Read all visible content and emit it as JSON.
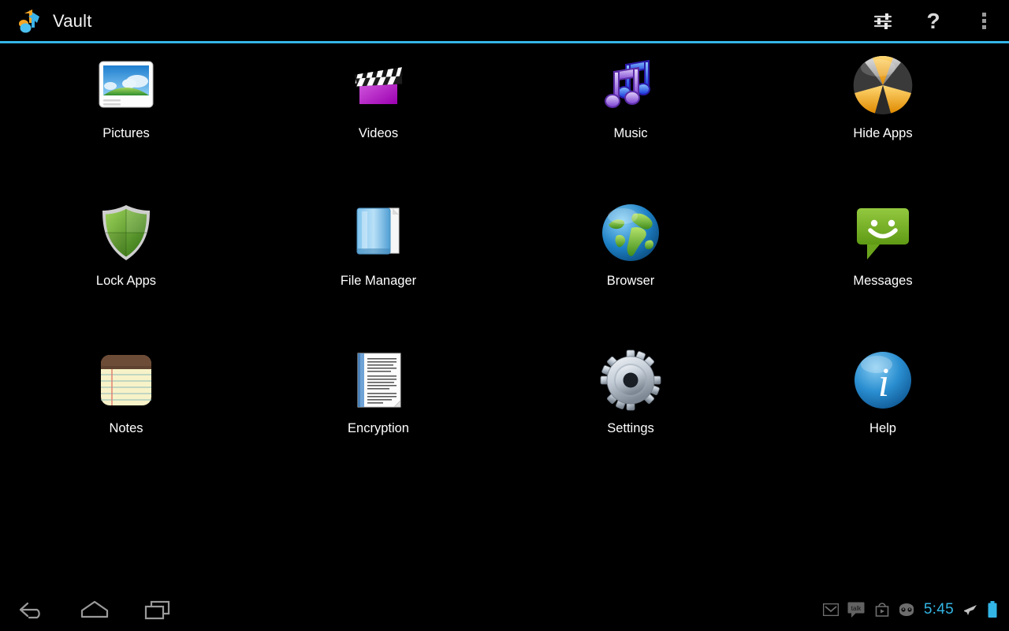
{
  "app": {
    "title": "Vault",
    "logo_icon": "music-note-logo-icon",
    "accent_color": "#33b5e5",
    "background_color": "#000000",
    "label_color": "#ffffff"
  },
  "action_bar": {
    "actions": [
      {
        "name": "settings-sliders-icon",
        "label": "Settings"
      },
      {
        "name": "help-question-icon",
        "label": "Help"
      },
      {
        "name": "overflow-menu-icon",
        "label": "More options"
      }
    ]
  },
  "grid": {
    "columns": 4,
    "items": [
      {
        "label": "Pictures",
        "icon": "pictures-icon"
      },
      {
        "label": "Videos",
        "icon": "videos-clapperboard-icon"
      },
      {
        "label": "Music",
        "icon": "music-notes-icon"
      },
      {
        "label": "Hide Apps",
        "icon": "hide-apps-radiation-icon"
      },
      {
        "label": "Lock Apps",
        "icon": "lock-apps-shield-icon"
      },
      {
        "label": "File Manager",
        "icon": "file-manager-folder-icon"
      },
      {
        "label": "Browser",
        "icon": "browser-globe-icon"
      },
      {
        "label": "Messages",
        "icon": "messages-bubble-icon"
      },
      {
        "label": "Notes",
        "icon": "notes-pad-icon"
      },
      {
        "label": "Encryption",
        "icon": "encryption-document-icon"
      },
      {
        "label": "Settings",
        "icon": "settings-gear-icon"
      },
      {
        "label": "Help",
        "icon": "help-info-icon"
      }
    ]
  },
  "nav_bar": {
    "buttons": [
      {
        "name": "back-button",
        "label": "Back"
      },
      {
        "name": "home-button",
        "label": "Home"
      },
      {
        "name": "recent-apps-button",
        "label": "Recent apps"
      }
    ]
  },
  "status_tray": {
    "icons": [
      {
        "name": "gmail-icon",
        "label": "Gmail"
      },
      {
        "name": "talk-icon",
        "label": "talk"
      },
      {
        "name": "play-store-icon",
        "label": "Play Store"
      },
      {
        "name": "cyanogenmod-icon",
        "label": "CyanogenMod"
      }
    ],
    "clock": "5:45",
    "airplane_icon": "airplane-mode-icon",
    "battery_icon": "battery-full-icon",
    "clock_color": "#33b5e5",
    "battery_color": "#33b5e5"
  }
}
